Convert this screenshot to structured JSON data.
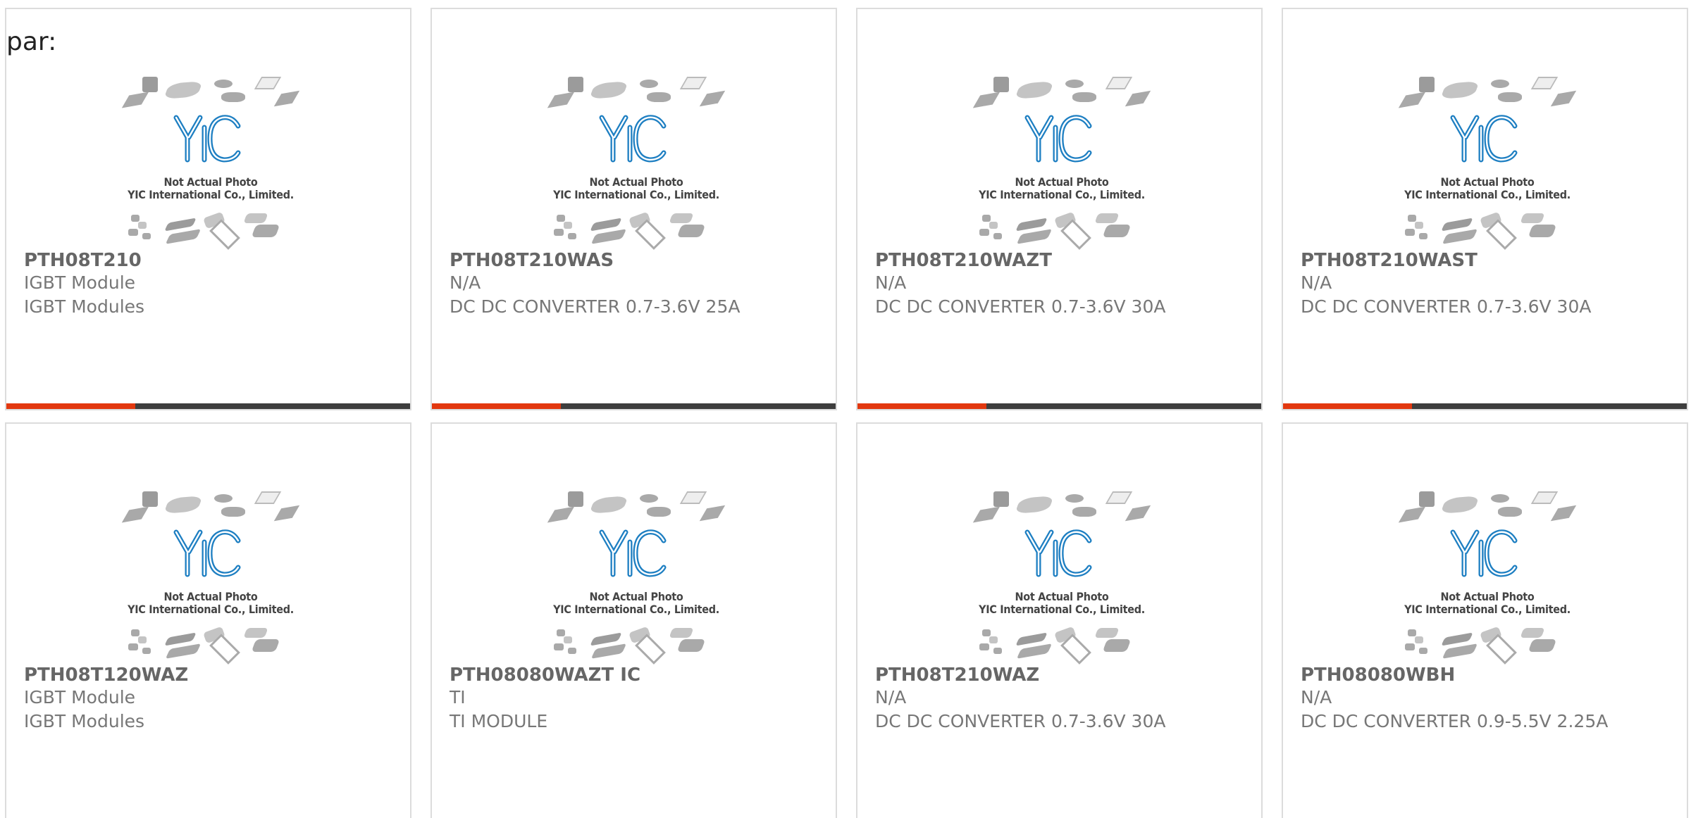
{
  "heading_prefix": "par:",
  "placeholder": {
    "line1": "Not Actual Photo",
    "line2": "YIC International Co., Limited.",
    "logo_text": "YIC",
    "logo_color": "#1e7fc2"
  },
  "colors": {
    "accent": "#e2380f",
    "bar_dark": "#3e3e3e",
    "border": "#dcdcdc"
  },
  "products": [
    {
      "part": "PTH08T210",
      "manufacturer": "IGBT Module",
      "description": "IGBT Modules"
    },
    {
      "part": "PTH08T210WAS",
      "manufacturer": "N/A",
      "description": "DC DC CONVERTER 0.7-3.6V 25A"
    },
    {
      "part": "PTH08T210WAZT",
      "manufacturer": "N/A",
      "description": "DC DC CONVERTER 0.7-3.6V 30A"
    },
    {
      "part": "PTH08T210WAST",
      "manufacturer": "N/A",
      "description": "DC DC CONVERTER 0.7-3.6V 30A"
    },
    {
      "part": "PTH08T120WAZ",
      "manufacturer": "IGBT Module",
      "description": "IGBT Modules"
    },
    {
      "part": "PTH08080WAZT IC",
      "manufacturer": "TI",
      "description": "TI MODULE"
    },
    {
      "part": "PTH08T210WAZ",
      "manufacturer": "N/A",
      "description": "DC DC CONVERTER 0.7-3.6V 30A"
    },
    {
      "part": "PTH08080WBH",
      "manufacturer": "N/A",
      "description": "DC DC CONVERTER 0.9-5.5V 2.25A"
    }
  ]
}
